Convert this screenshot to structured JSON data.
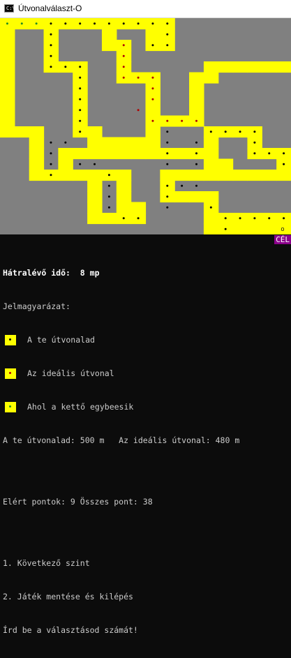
{
  "window": {
    "title": "Útvonalválaszt-O",
    "icon": "console-app-icon"
  },
  "colors": {
    "field": "#808080",
    "road": "#ffff00",
    "your_route_dot": "#000000",
    "ideal_route_dot": "#b00000",
    "both_dot": "#228b22",
    "goal_label_bg": "#8b008b"
  },
  "goal": {
    "label": "CÉL",
    "marker": "o"
  },
  "status": {
    "time_label": "Hátralévő idő:",
    "time_value": "8 mp",
    "legend_title": "Jelmagyarázat:",
    "legend": [
      {
        "label": "A te útvonalad",
        "dot": "black"
      },
      {
        "label": "Az ideális útvonal",
        "dot": "red"
      },
      {
        "label": "Ahol a kettő egybeesik",
        "dot": "green"
      }
    ],
    "distances": "A te útvonalad: 500 m   Az ideális útvonal: 480 m",
    "points": "Elért pontok: 9 Összes pont: 38",
    "menu": [
      "1. Következő szint",
      "2. Játék mentése és kilépés"
    ],
    "prompt": "Írd be a választásod számát!"
  }
}
